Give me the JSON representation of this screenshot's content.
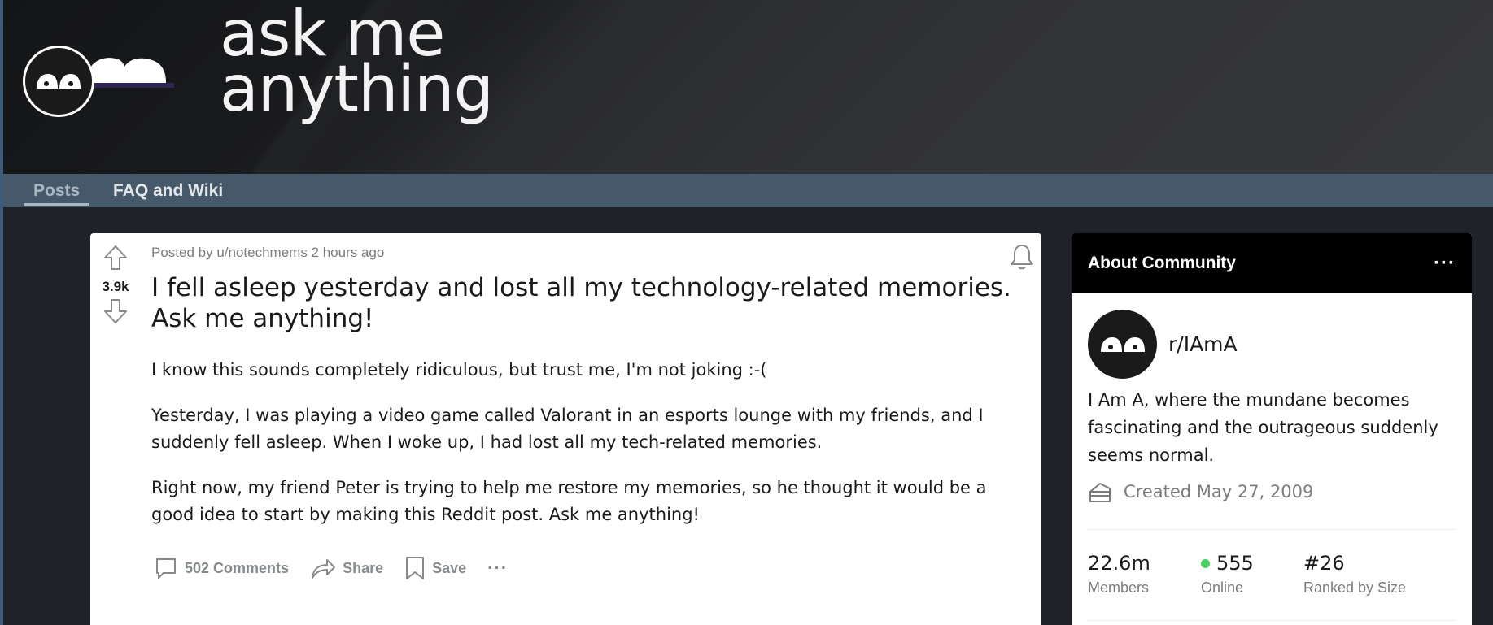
{
  "banner": {
    "title_line1": "ask me",
    "title_line2": "anything",
    "logo_text": "ama"
  },
  "nav": {
    "tabs": [
      {
        "label": "Posts",
        "active": true
      },
      {
        "label": "FAQ and Wiki",
        "active": false
      }
    ]
  },
  "post": {
    "vote_count": "3.9k",
    "meta": "Posted by u/notechmems 2 hours ago",
    "title": "I fell asleep yesterday and lost all my technology-related memories. Ask me anything!",
    "paragraphs": [
      "I know this sounds completely ridiculous, but trust me, I'm not joking :-(",
      "Yesterday, I was playing a video game called Valorant in an esports lounge with my friends, and I suddenly fell asleep. When I woke up, I had lost all my tech-related memories.",
      "Right now, my friend Peter is trying to help me restore my memories, so he thought it would be a good idea to start by making this Reddit post. Ask me anything!"
    ],
    "actions": {
      "comments": "502 Comments",
      "share": "Share",
      "save": "Save",
      "more": "···"
    }
  },
  "about": {
    "header": "About Community",
    "more": "···",
    "community_name": "r/IAmA",
    "description": "I Am A, where the mundane becomes fascinating and the outrageous suddenly seems normal.",
    "created": "Created May 27, 2009",
    "stats": [
      {
        "value": "22.6m",
        "label": "Members"
      },
      {
        "value": "555",
        "label": "Online"
      },
      {
        "value": "#26",
        "label": "Ranked by Size"
      }
    ]
  },
  "colors": {
    "nav_bg": "#45596a",
    "online": "#46d160",
    "about_header_bg": "#000000"
  }
}
